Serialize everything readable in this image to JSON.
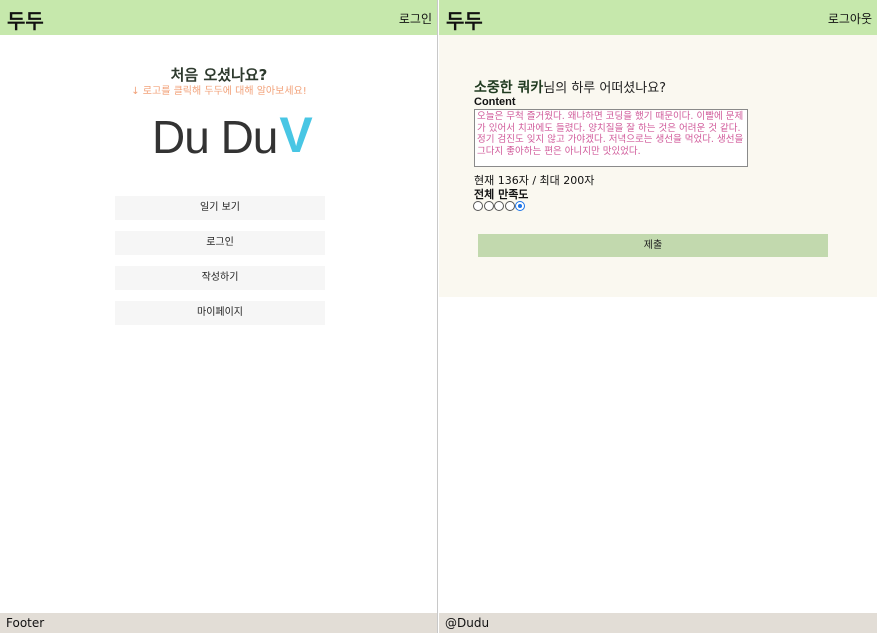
{
  "left": {
    "header": {
      "brand": "두두",
      "login_link": "로그인"
    },
    "intro": {
      "title": "처음 오셨나요?",
      "subtitle": "↓ 로고를 클릭해 두두에 대해 알아보세요!"
    },
    "logo": {
      "text": "Du Du",
      "accent": "V"
    },
    "menu": [
      {
        "label": "일기 보기"
      },
      {
        "label": "로그인"
      },
      {
        "label": "작성하기"
      },
      {
        "label": "마이페이지"
      }
    ],
    "footer": "Footer"
  },
  "right": {
    "header": {
      "brand": "두두",
      "logout_link": "로그아웃"
    },
    "greeting": {
      "nickname": "소중한 쿼카",
      "suffix": "님의 하루 어떠셨나요?"
    },
    "content_label": "Content",
    "content_value": "오늘은 무척 즐거웠다. 왜냐하면 코딩을 했기 때문이다. 이빨에 문제가 있어서 치과에도 들렸다. 양치질을 잘 하는 것은 어려운 것 같다. 정기 검진도 잊지 않고 가야겠다. 저녁으로는 생선을 먹었다. 생선을 그다지 좋아하는 편은 아니지만 맛있었다.",
    "counter": "현재 136자 / 최대 200자",
    "rating": {
      "label": "전체 만족도",
      "options": 5,
      "selected": 5
    },
    "submit_label": "제출",
    "footer": "@Dudu"
  },
  "colors": {
    "header_bg": "#c6e8ac",
    "footer_bg": "#e2ddd6",
    "card_bg": "#faf8f0",
    "submit_bg": "#c2d9ae",
    "logo_accent": "#48c6e4",
    "hint_text": "#f2a27a",
    "textarea_text": "#d05a9a"
  }
}
